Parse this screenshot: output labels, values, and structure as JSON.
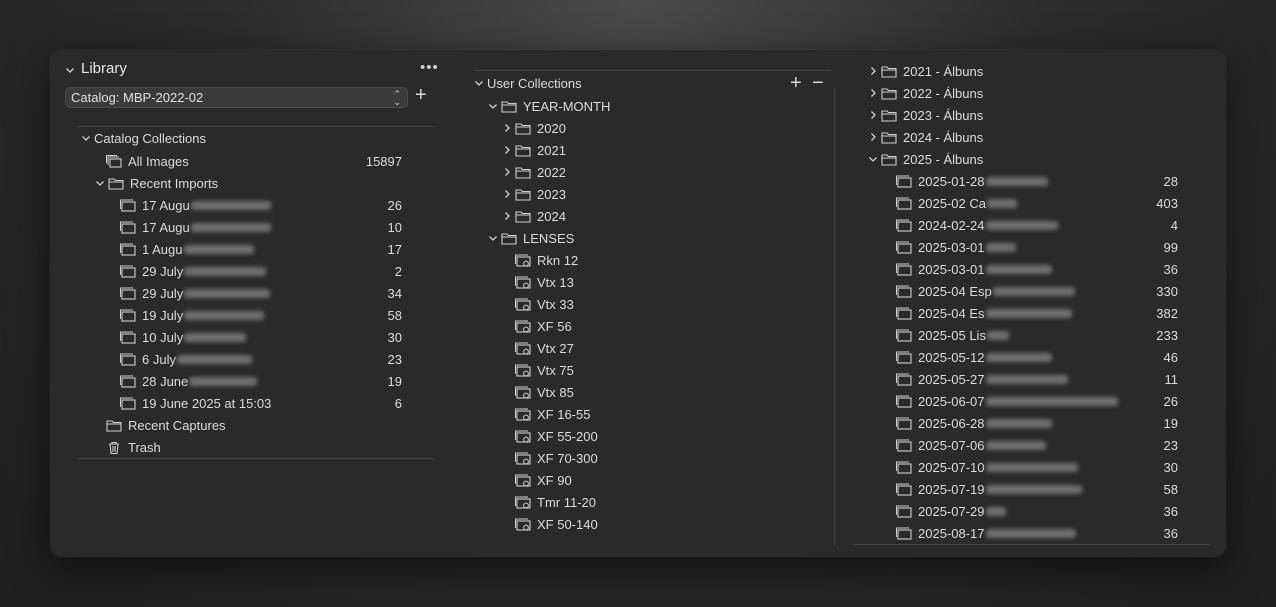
{
  "library": {
    "title": "Library",
    "more_label": "•••",
    "catalog_selected": "Catalog: MBP-2022-02",
    "add_label": "+",
    "catalog_collections_label": "Catalog Collections",
    "all_images": {
      "label": "All Images",
      "count": "15897"
    },
    "recent_imports_label": "Recent Imports",
    "imports": [
      {
        "label": "17 Augu",
        "count": "26"
      },
      {
        "label": "17 Augu",
        "count": "10"
      },
      {
        "label": "1 Augu",
        "count": "17"
      },
      {
        "label": "29 July",
        "count": "2"
      },
      {
        "label": "29 July",
        "count": "34"
      },
      {
        "label": "19 July",
        "count": "58"
      },
      {
        "label": "10 July",
        "count": "30"
      },
      {
        "label": "6 July",
        "count": "23"
      },
      {
        "label": "28 June",
        "count": "19"
      },
      {
        "label": "19 June 2025 at 15:03",
        "count": "6"
      }
    ],
    "recent_captures_label": "Recent Captures",
    "trash_label": "Trash"
  },
  "user_collections": {
    "title": "User Collections",
    "add_label": "+",
    "remove_label": "−",
    "year_month_label": "YEAR-MONTH",
    "years": [
      "2020",
      "2021",
      "2022",
      "2023",
      "2024"
    ],
    "lenses_label": "LENSES",
    "lenses": [
      "Rkn 12",
      "Vtx 13",
      "Vtx 33",
      "XF 56",
      "Vtx 27",
      "Vtx 75",
      "Vtx 85",
      "XF 16-55",
      "XF 55-200",
      "XF 70-300",
      "XF 90",
      "Tmr 11-20",
      "XF 50-140"
    ]
  },
  "albums": {
    "folders": [
      "2021 - Álbuns",
      "2022 - Álbuns",
      "2023 - Álbuns",
      "2024 - Álbuns",
      "2025 - Álbuns"
    ],
    "items": [
      {
        "label": "2025-01-28",
        "count": "28"
      },
      {
        "label": "2025-02 Ca",
        "count": "403"
      },
      {
        "label": "2024-02-24",
        "count": "4"
      },
      {
        "label": "2025-03-01",
        "count": "99"
      },
      {
        "label": "2025-03-01",
        "count": "36"
      },
      {
        "label": "2025-04 Esp",
        "count": "330"
      },
      {
        "label": "2025-04 Es",
        "count": "382"
      },
      {
        "label": "2025-05 Lis",
        "count": "233"
      },
      {
        "label": "2025-05-12",
        "count": "46"
      },
      {
        "label": "2025-05-27",
        "count": "11"
      },
      {
        "label": "2025-06-07",
        "count": "26"
      },
      {
        "label": "2025-06-28",
        "count": "19"
      },
      {
        "label": "2025-07-06",
        "count": "23"
      },
      {
        "label": "2025-07-10",
        "count": "30"
      },
      {
        "label": "2025-07-19",
        "count": "58"
      },
      {
        "label": "2025-07-29",
        "count": "36"
      },
      {
        "label": "2025-08-17",
        "count": "36"
      }
    ]
  },
  "colors": {
    "window_bg": "#2a2a2a",
    "text": "#dcdcdc",
    "separator": "#454545"
  }
}
